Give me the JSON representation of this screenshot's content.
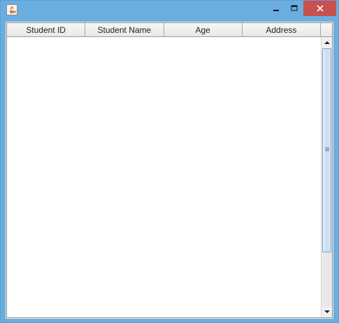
{
  "window": {
    "controls": {
      "minimize_icon": "minimize-icon",
      "maximize_icon": "maximize-icon",
      "close_icon": "close-icon"
    },
    "app_icon": "java-cup-icon",
    "frame_color": "#6aaee0",
    "close_color": "#c75050"
  },
  "table": {
    "columns": [
      "Student ID",
      "Student Name",
      "Age",
      "Address"
    ],
    "rows": []
  },
  "scrollbar": {
    "up_icon": "scroll-up-arrow-icon",
    "down_icon": "scroll-down-arrow-icon",
    "thumb_color": "#c9dcf3"
  }
}
